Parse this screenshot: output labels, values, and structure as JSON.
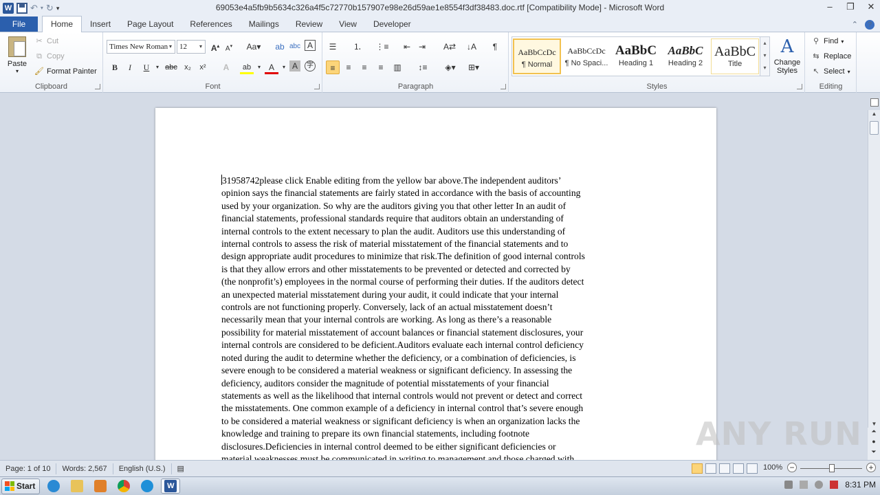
{
  "titlebar": {
    "title": "69053e4a5fb9b5634c326a4f5c72770b157907e98e26d59ae1e8554f3df38483.doc.rtf [Compatibility Mode] - Microsoft Word",
    "app_icon": "W",
    "minimize": "–",
    "restore": "❐",
    "close": "✕"
  },
  "tabs": {
    "file": "File",
    "items": [
      "Home",
      "Insert",
      "Page Layout",
      "References",
      "Mailings",
      "Review",
      "View",
      "Developer"
    ]
  },
  "clipboard": {
    "paste": "Paste",
    "cut": "Cut",
    "copy": "Copy",
    "format_painter": "Format Painter",
    "label": "Clipboard"
  },
  "font": {
    "name": "Times New Roman",
    "size": "12",
    "label": "Font"
  },
  "paragraph": {
    "label": "Paragraph"
  },
  "styles": {
    "label": "Styles",
    "items": [
      {
        "sample": "AaBbCcDc",
        "name": "¶ Normal"
      },
      {
        "sample": "AaBbCcDc",
        "name": "¶ No Spaci..."
      },
      {
        "sample": "AaBbC",
        "name": "Heading 1"
      },
      {
        "sample": "AaBbC",
        "name": "Heading 2"
      },
      {
        "sample": "AaBbC",
        "name": "Title"
      }
    ],
    "change_styles": "Change Styles"
  },
  "editing": {
    "find": "Find",
    "replace": "Replace",
    "select": "Select",
    "label": "Editing"
  },
  "document": {
    "lines": [
      "31958742please click Enable editing from the yellow bar above.The independent auditors’",
      "opinion says the financial statements are fairly stated in accordance with the basis of accounting",
      "used by your organization. So why are the auditors giving you that other letter In an audit of",
      "financial statements, professional standards require that auditors obtain an understanding of",
      "internal controls to the extent necessary to plan the audit. Auditors use this understanding of",
      "internal controls to assess the risk of material misstatement of the financial statements and to",
      "design appropriate audit procedures to minimize that risk.The definition of good internal controls",
      "is that they allow errors and other misstatements to be prevented or detected and corrected by",
      "(the nonprofit’s) employees in the normal course of performing their duties. If the auditors detect",
      "an unexpected material misstatement during your audit, it could indicate that your internal",
      "controls are not functioning properly. Conversely, lack of an actual misstatement doesn’t",
      "necessarily mean that your internal controls are working. As long as there’s a reasonable",
      "possibility for material misstatement of account balances or financial statement disclosures, your",
      "internal controls are considered to be deficient.Auditors evaluate each internal control deficiency",
      "noted during the audit to determine whether the deficiency, or a combination of deficiencies, is",
      "severe enough to be considered a material weakness or significant deficiency. In assessing the",
      "deficiency, auditors consider the magnitude of potential misstatements of your financial",
      "statements as well as the likelihood that internal controls would not prevent or detect and correct",
      "the misstatements. One common example of a deficiency in internal control that’s severe enough",
      "to be considered a material weakness or significant deficiency is when an organization lacks the",
      "knowledge and training to prepare its own financial statements, including footnote",
      "disclosures.Deficiencies in internal control deemed to be either significant deficiencies or",
      "material weaknesses must be communicated in writing to management and those charged with"
    ]
  },
  "statusbar": {
    "page": "Page: 1 of 10",
    "words": "Words: 2,567",
    "language": "English (U.S.)",
    "zoom": "100%",
    "zoom_minus": "−",
    "zoom_plus": "+"
  },
  "taskbar": {
    "start": "Start",
    "time": "8:31 PM"
  },
  "watermark": "ANY RUN"
}
